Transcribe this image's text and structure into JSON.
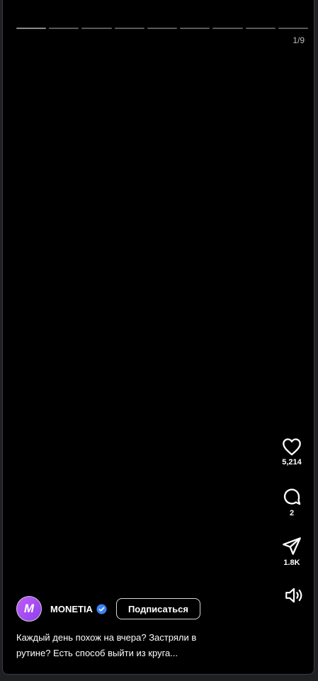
{
  "story": {
    "segments_total": 9,
    "counter": "1/9"
  },
  "actions": {
    "like_count": "5,214",
    "comment_count": "2",
    "share_count": "1.8K"
  },
  "author": {
    "avatar_letter": "M",
    "username": "MONETIA",
    "follow_label": "Подписаться"
  },
  "caption": "Каждый день похож на вчера? Застряли в рутине? Есть способ выйти из круга...",
  "colors": {
    "background": "#000000",
    "verified": "#3b82f6",
    "avatar_gradient_start": "#c45bf7",
    "avatar_gradient_end": "#8b3ff0"
  },
  "icons": [
    "heart-icon",
    "comment-icon",
    "share-icon",
    "speaker-icon",
    "verified-badge-icon"
  ]
}
